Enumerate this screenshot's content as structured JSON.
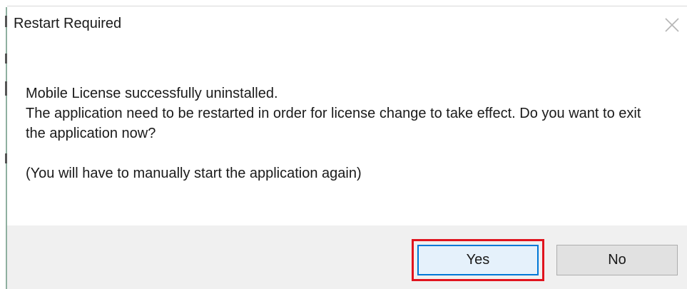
{
  "dialog": {
    "title": "Restart Required",
    "close_icon": "close-icon",
    "message": {
      "line1": "Mobile License successfully uninstalled.",
      "line2": "The application need to be restarted in order for license change to take effect. Do you want to exit the application now?",
      "line3": "(You will have to manually start the application again)"
    },
    "buttons": {
      "yes_label": "Yes",
      "no_label": "No"
    }
  },
  "colors": {
    "highlight": "#e0141e",
    "focus_border": "#0078d7",
    "footer_background": "#f0f0f0"
  }
}
